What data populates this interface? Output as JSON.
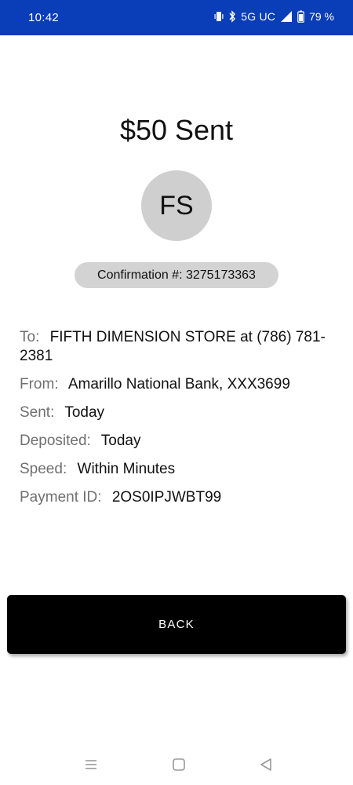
{
  "status_bar": {
    "time": "10:42",
    "network": "5G UC",
    "battery": "79 %"
  },
  "title": "$50 Sent",
  "avatar_initials": "FS",
  "confirmation": "Confirmation #: 3275173363",
  "details": [
    {
      "label": "To:",
      "value": "FIFTH DIMENSION STORE at (786) 781-2381"
    },
    {
      "label": "From:",
      "value": "Amarillo National Bank, XXX3699"
    },
    {
      "label": "Sent:",
      "value": "Today"
    },
    {
      "label": "Deposited:",
      "value": "Today"
    },
    {
      "label": "Speed:",
      "value": "Within Minutes"
    },
    {
      "label": "Payment ID:",
      "value": "2OS0IPJWBT99"
    }
  ],
  "back_button": "BACK",
  "colors": {
    "status_bar_bg": "#0a3db8",
    "avatar_bg": "#cfcfcf",
    "pill_bg": "#d3d3d3",
    "button_bg": "#000000",
    "label_gray": "#707070"
  },
  "nav_icons": [
    "menu-icon",
    "home-icon",
    "back-icon"
  ]
}
